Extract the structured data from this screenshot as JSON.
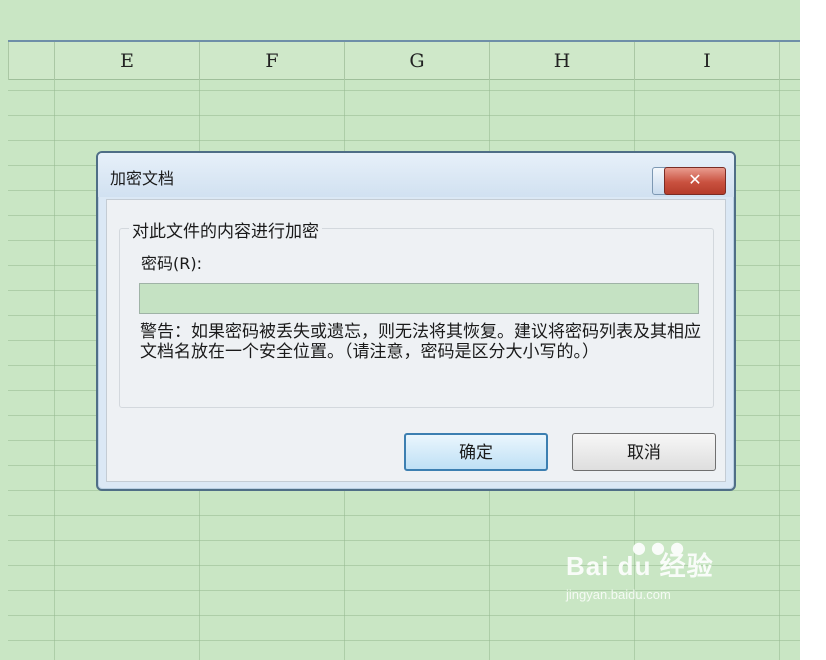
{
  "columns": [
    "E",
    "F",
    "G",
    "H",
    "I"
  ],
  "dialog": {
    "title": "加密文档",
    "help_glyph": "?",
    "close_glyph": "✕",
    "group_title": "对此文件的内容进行加密",
    "password_label": "密码(R):",
    "password_value": "",
    "warning_text": "警告：如果密码被丢失或遗忘，则无法将其恢复。建议将密码列表及其相应文档名放在一个安全位置。（请注意，密码是区分大小写的。）",
    "ok_label": "确定",
    "cancel_label": "取消"
  },
  "watermark": {
    "logo_text": "Bai du 经验",
    "sub_text": "jingyan.baidu.com"
  }
}
